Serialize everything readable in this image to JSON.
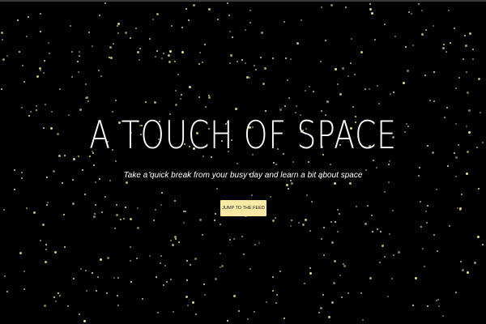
{
  "hero": {
    "title": "A TOUCH OF SPACE",
    "subtitle": "Take a quick break from your busy day and learn a bit about space",
    "cta_label": "JUMP TO THE FEED"
  },
  "colors": {
    "background": "#000000",
    "star": "#f3e9a6",
    "button": "#fbeaa6",
    "text": "#ffffff"
  }
}
